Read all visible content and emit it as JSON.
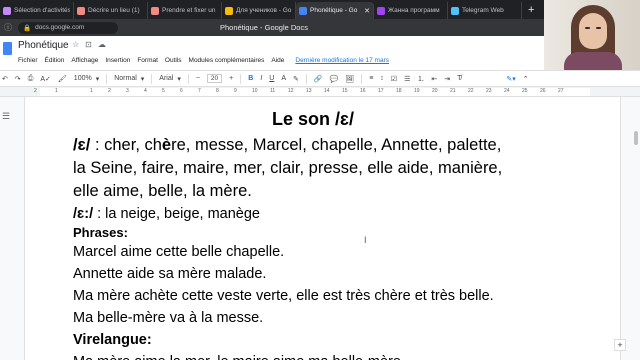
{
  "tabs": [
    {
      "label": "Sélection d'activités",
      "color": "#c58af9",
      "active": false
    },
    {
      "label": "Décrire un lieu (1)",
      "color": "#f28b82",
      "active": false
    },
    {
      "label": "Prendre et fixer un",
      "color": "#f28b82",
      "active": false
    },
    {
      "label": "Для учеников - Go",
      "color": "#fbbc04",
      "active": false
    },
    {
      "label": "Phonétique - Go",
      "color": "#4285f4",
      "active": true
    },
    {
      "label": "Жанна программ",
      "color": "#a142f4",
      "active": false
    },
    {
      "label": "Telegram Web",
      "color": "#4fc3f7",
      "active": false
    }
  ],
  "new_tab": "+",
  "close_tab": "✕",
  "window_title": "Phonétique - Google Docs",
  "url": "docs.google.com",
  "doc": {
    "title": "Phonétique",
    "menu": [
      "Fichier",
      "Édition",
      "Affichage",
      "Insertion",
      "Format",
      "Outils",
      "Modules complémentaires",
      "Aide"
    ],
    "last_edit": "Dernière modification le 17 mars"
  },
  "toolbar": {
    "zoom_glyph": "100%",
    "style": "Normal",
    "font": "Arial",
    "font_size": "20",
    "bold": "B",
    "italic": "I",
    "underline": "U",
    "text_color": "A"
  },
  "ruler": [
    "2",
    "1",
    "1",
    "2",
    "3",
    "4",
    "5",
    "6",
    "7",
    "8",
    "9",
    "10",
    "11",
    "12",
    "13",
    "14",
    "15",
    "16",
    "17",
    "18",
    "19",
    "20",
    "21",
    "22",
    "23",
    "24",
    "25",
    "26",
    "27"
  ],
  "content": {
    "heading": "Le son /ɛ/",
    "line1_label": "/ɛ/",
    "line1_pre": " : cher, ch",
    "line1_bold": "è",
    "line1_post": "re, messe, Marcel, chapelle, Annette, palette,",
    "line2": "la Seine, faire, maire, mer, clair, presse, elle aide, manière,",
    "line3": "elle aime, belle, la mère.",
    "line4_label": "/ɛ:/",
    "line4_text": " : la neige, beige, manège",
    "phrases_label": "Phrases:",
    "phrase1": "Marcel aime cette belle chapelle.",
    "phrase2": "Annette aide sa mère malade.",
    "phrase3": "Ma mère achète cette veste verte, elle est très chère et très belle.",
    "phrase4": "Ma belle-mère va à la messe.",
    "virelangue_label": "Virelangue:",
    "virelangue_line": "Ma mère aime la mer, le maire aime ma belle-mère."
  },
  "colors": {
    "accent": "#1a73e8",
    "tab_bg": "#202124",
    "docs_blue": "#4285f4"
  }
}
